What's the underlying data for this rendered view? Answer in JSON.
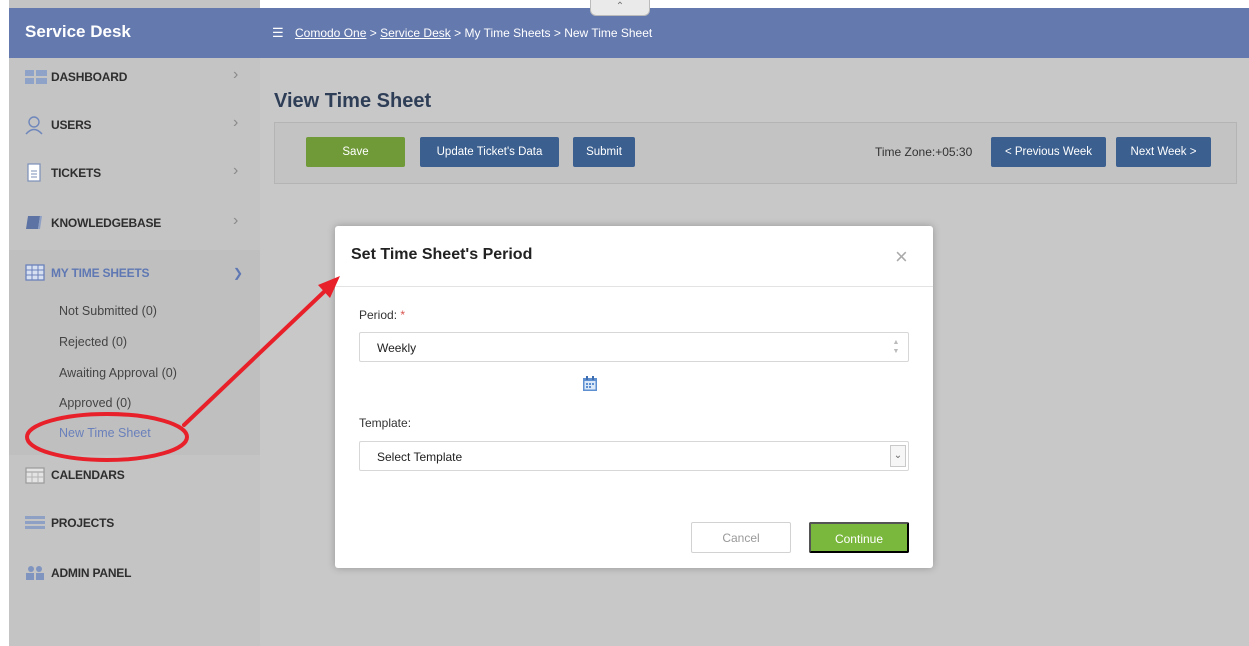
{
  "sidebar": {
    "title": "Service Desk",
    "items": [
      {
        "label": "DASHBOARD"
      },
      {
        "label": "USERS"
      },
      {
        "label": "TICKETS"
      },
      {
        "label": "KNOWLEDGEBASE"
      },
      {
        "label": "MY TIME SHEETS"
      },
      {
        "label": "CALENDARS"
      },
      {
        "label": "PROJECTS"
      },
      {
        "label": "ADMIN PANEL"
      }
    ],
    "sub_items": [
      {
        "label": "Not Submitted (0)"
      },
      {
        "label": "Rejected (0)"
      },
      {
        "label": "Awaiting Approval (0)"
      },
      {
        "label": "Approved (0)"
      },
      {
        "label": "New Time Sheet"
      }
    ]
  },
  "breadcrumb": {
    "items": [
      "Comodo One",
      "Service Desk",
      "My Time Sheets",
      "New Time Sheet"
    ],
    "separator": ">"
  },
  "page": {
    "title": "View Time Sheet"
  },
  "toolbar": {
    "save_label": "Save",
    "update_label": "Update Ticket's Data",
    "submit_label": "Submit",
    "timezone": "Time Zone:+05:30",
    "prev_label": "< Previous Week",
    "next_label": "Next Week >"
  },
  "modal": {
    "title": "Set Time Sheet's Period",
    "period_label": "Period:",
    "required_mark": "*",
    "period_value": "Weekly",
    "template_label": "Template:",
    "template_value": "Select Template",
    "cancel_label": "Cancel",
    "continue_label": "Continue"
  },
  "colors": {
    "header_blue": "#6479ae",
    "button_blue": "#3b5f8f",
    "save_green": "#6f9a37",
    "continue_green": "#7ab83d",
    "annotation_red": "#e8202a"
  },
  "icons": {
    "menu": "hamburger-icon",
    "dashboard": "dashboard-icon",
    "users": "user-icon",
    "tickets": "ticket-icon",
    "knowledgebase": "book-icon",
    "time_sheets": "table-icon",
    "calendars": "calendar-icon",
    "projects": "projects-icon",
    "admin": "admin-icon",
    "close": "close-icon",
    "date": "calendar-icon"
  }
}
